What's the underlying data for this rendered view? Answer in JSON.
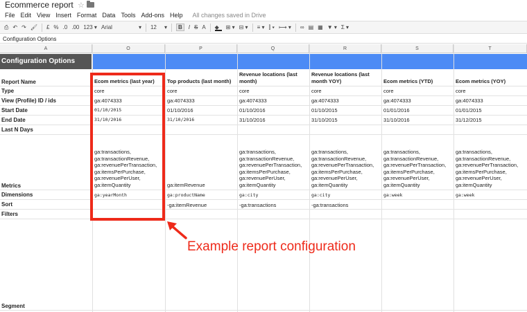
{
  "app": {
    "doc_title": "Ecommerce report",
    "save_status": "All changes saved in Drive",
    "menu": [
      "File",
      "Edit",
      "View",
      "Insert",
      "Format",
      "Data",
      "Tools",
      "Add-ons",
      "Help"
    ]
  },
  "toolbar": {
    "currency": "£",
    "percent": "%",
    "dec_decrease": ".0",
    "dec_increase": ".00",
    "number_format": "123",
    "font": "Arial",
    "font_size": "12",
    "bold": "B",
    "italic": "I",
    "strike": "S",
    "text_color": "A"
  },
  "formula_bar": {
    "value": "Configuration Options"
  },
  "columns": [
    "A",
    "O",
    "P",
    "Q",
    "R",
    "S",
    "T"
  ],
  "band": {
    "title": "Configuration Options",
    "color": "#4c8bf5"
  },
  "row_labels": {
    "report_name": "Report Name",
    "type": "Type",
    "view_id": "View (Profile) ID / ids",
    "start_date": "Start Date",
    "end_date": "End Date",
    "last_n_days": "Last N Days",
    "metrics": "Metrics",
    "dimensions": "Dimensions",
    "sort": "Sort",
    "filters": "Filters",
    "segment": "Segment"
  },
  "reports": [
    {
      "name": [
        "Ecom metrics (last year)"
      ],
      "type": "core",
      "view_id": "ga:4074333",
      "start_date": "01/10/2015",
      "end_date": "31/10/2016",
      "metrics": [
        "ga:transactions,",
        "ga:transactionRevenue,",
        "ga:revenuePerTransaction,",
        "ga:itemsPerPurchase,",
        "ga:revenuePerUser,",
        "ga:itemQuantity"
      ],
      "dimensions": "ga:yearMonth",
      "sort": ""
    },
    {
      "name": [
        "Top products (last month)"
      ],
      "type": "core",
      "view_id": "ga:4074333",
      "start_date": "01/10/2016",
      "end_date": "31/10/2016",
      "metrics": [
        "ga:itemRevenue"
      ],
      "dimensions": "ga:productName",
      "sort": "-ga:itemRevenue"
    },
    {
      "name": [
        "Revenue locations (last",
        "month)"
      ],
      "type": "core",
      "view_id": "ga:4074333",
      "start_date": "01/10/2016",
      "end_date": "31/10/2016",
      "metrics": [
        "ga:transactions,",
        "ga:transactionRevenue,",
        "ga:revenuePerTransaction,",
        "ga:itemsPerPurchase,",
        "ga:revenuePerUser,",
        "ga:itemQuantity"
      ],
      "dimensions": "ga:city",
      "sort": "-ga:transactions"
    },
    {
      "name": [
        "Revenue locations (last",
        "month YOY)"
      ],
      "type": "core",
      "view_id": "ga:4074333",
      "start_date": "01/10/2015",
      "end_date": "31/10/2015",
      "metrics": [
        "ga:transactions,",
        "ga:transactionRevenue,",
        "ga:revenuePerTransaction,",
        "ga:itemsPerPurchase,",
        "ga:revenuePerUser,",
        "ga:itemQuantity"
      ],
      "dimensions": "ga:city",
      "sort": "-ga:transactions"
    },
    {
      "name": [
        "Ecom metrics (YTD)"
      ],
      "type": "core",
      "view_id": "ga:4074333",
      "start_date": "01/01/2016",
      "end_date": "31/10/2016",
      "metrics": [
        "ga:transactions,",
        "ga:transactionRevenue,",
        "ga:revenuePerTransaction,",
        "ga:itemsPerPurchase,",
        "ga:revenuePerUser,",
        "ga:itemQuantity"
      ],
      "dimensions": "ga:week",
      "sort": ""
    },
    {
      "name": [
        "Ecom metrics (YOY)"
      ],
      "type": "core",
      "view_id": "ga:4074333",
      "start_date": "01/01/2015",
      "end_date": "31/12/2015",
      "metrics": [
        "ga:transactions,",
        "ga:transactionRevenue,",
        "ga:revenuePerTransaction,",
        "ga:itemsPerPurchase,",
        "ga:revenuePerUser,",
        "ga:itemQuantity"
      ],
      "dimensions": "ga:week",
      "sort": ""
    }
  ],
  "annotation": {
    "text": "Example report configuration",
    "color": "#ee2a1a"
  }
}
